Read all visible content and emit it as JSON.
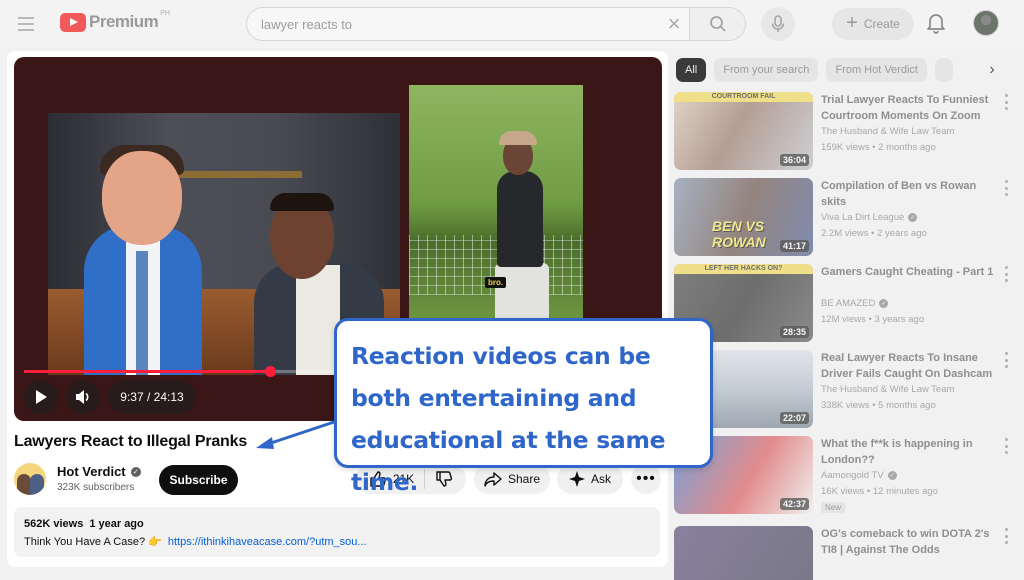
{
  "header": {
    "logo_text": "Premium",
    "logo_sup": "PH",
    "search_value": "lawyer reacts to",
    "create_label": "Create"
  },
  "video": {
    "caption": "bro.",
    "time": "9:37 / 24:13",
    "progress": 0.397,
    "title": "Lawyers React to Illegal Pranks",
    "channel": "Hot Verdict",
    "subscribers": "323K subscribers",
    "subscribe_label": "Subscribe",
    "likes": "21K",
    "share_label": "Share",
    "ask_label": "Ask",
    "views": "562K views",
    "age": "1 year ago",
    "desc_text": "Think You Have A Case? 👉",
    "desc_link": "https://ithinkihaveacase.com/?utm_sou..."
  },
  "chips": [
    "All",
    "From your search",
    "From Hot Verdict",
    ""
  ],
  "recommendations": [
    {
      "title": "Trial Lawyer Reacts To Funniest Courtroom Moments On Zoom",
      "channel": "The Husband & Wife Law Team",
      "verified": false,
      "meta": "159K views • 2 months ago",
      "duration": "36:04",
      "banner": "COURTROOM FAIL",
      "word": ""
    },
    {
      "title": "Compilation of Ben vs Rowan skits",
      "channel": "Viva La Dirt League",
      "verified": true,
      "meta": "2.2M views • 2 years ago",
      "duration": "41:17",
      "banner": "",
      "word": "BEN VS ROWAN"
    },
    {
      "title": "Gamers Caught Cheating - Part 1",
      "channel": "BE AMAZED",
      "verified": true,
      "meta": "12M views • 3 years ago",
      "duration": "28:35",
      "banner": "LEFT HER HACKS ON?",
      "word": ""
    },
    {
      "title": "Real Lawyer Reacts To Insane Driver Fails Caught On Dashcam",
      "channel": "The Husband & Wife Law Team",
      "verified": false,
      "meta": "338K views • 5 months ago",
      "duration": "22:07",
      "banner": "",
      "word": ""
    },
    {
      "title": "What the f**k is happening in London??",
      "channel": "Aamongold TV",
      "verified": true,
      "meta": "16K views • 12 minutes ago",
      "duration": "42:37",
      "banner": "",
      "word": "",
      "badge": "New"
    },
    {
      "title": "OG's comeback to win DOTA 2's TI8 | Against The Odds",
      "channel": "",
      "verified": false,
      "meta": "",
      "duration": "",
      "banner": "",
      "word": ""
    }
  ],
  "callout": {
    "text": "Reaction videos can be both entertaining and educational at the same time."
  },
  "colors": {
    "callout_blue": "#2e66c9",
    "progress_red": "#ff1f3d",
    "link_blue": "#065fd4"
  }
}
